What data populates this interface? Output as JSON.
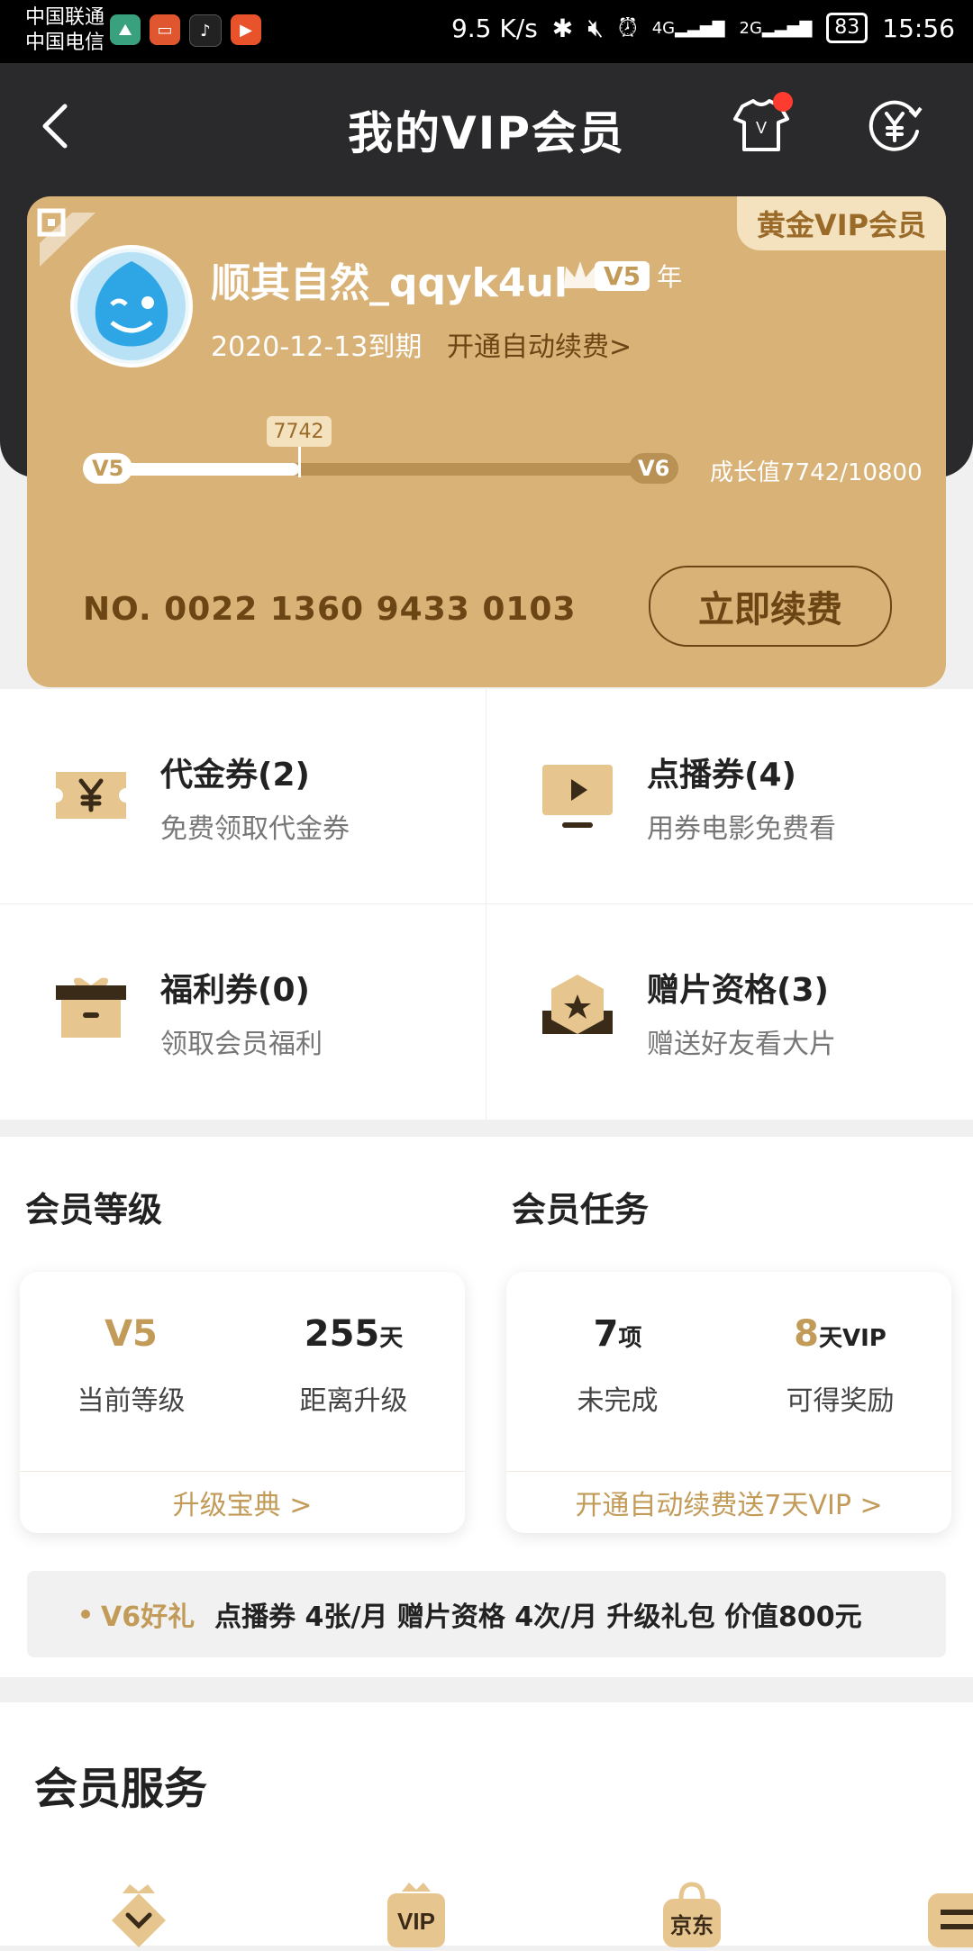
{
  "status_bar": {
    "carrier1": "中国联通",
    "carrier2": "中国电信",
    "speed": "9.5 K/s",
    "battery": "83",
    "time": "15:56"
  },
  "header": {
    "title": "我的VIP会员"
  },
  "vip_card": {
    "badge": "黄金VIP会员",
    "username": "顺其自然_qqyk4ul",
    "level": "V5",
    "level_suffix": "年",
    "expire": "2020-12-13到期",
    "autorenew": "开通自动续费>",
    "progress": {
      "start_label": "V5",
      "end_label": "V6",
      "current": 7742,
      "current_label": "7742",
      "target": 10800,
      "growth_text": "成长值7742/10800"
    },
    "card_number": "NO. 0022 1360 9433 0103",
    "renew_button": "立即续费"
  },
  "coupons": [
    {
      "title": "代金券(2)",
      "subtitle": "免费领取代金券",
      "icon": "yen-ticket-icon"
    },
    {
      "title": "点播券(4)",
      "subtitle": "用券电影免费看",
      "icon": "play-screen-icon"
    },
    {
      "title": "福利券(0)",
      "subtitle": "领取会员福利",
      "icon": "gift-box-icon"
    },
    {
      "title": "赠片资格(3)",
      "subtitle": "赠送好友看大片",
      "icon": "star-badge-icon"
    }
  ],
  "member_level": {
    "title": "会员等级",
    "current_level": "V5",
    "current_level_label": "当前等级",
    "days": "255",
    "days_unit": "天",
    "days_label": "距离升级",
    "link": "升级宝典 >"
  },
  "member_tasks": {
    "title": "会员任务",
    "pending": "7",
    "pending_unit": "项",
    "pending_label": "未完成",
    "reward": "8",
    "reward_unit": "天VIP",
    "reward_label": "可得奖励",
    "link": "开通自动续费送7天VIP >"
  },
  "perks": {
    "tag": "V6好礼",
    "text": "点播券 4张/月  赠片资格 4次/月  升级礼包 价值800元"
  },
  "services": {
    "title": "会员服务",
    "icons": [
      "down-badge-icon",
      "vip-badge-icon",
      "jd-bag-icon",
      "menu-icon"
    ],
    "labels": [
      "VIP",
      "京东"
    ]
  },
  "colors": {
    "gold": "#d9b277",
    "accent": "#c29b58",
    "dark": "#2a2a2c",
    "brown": "#6b4513"
  }
}
